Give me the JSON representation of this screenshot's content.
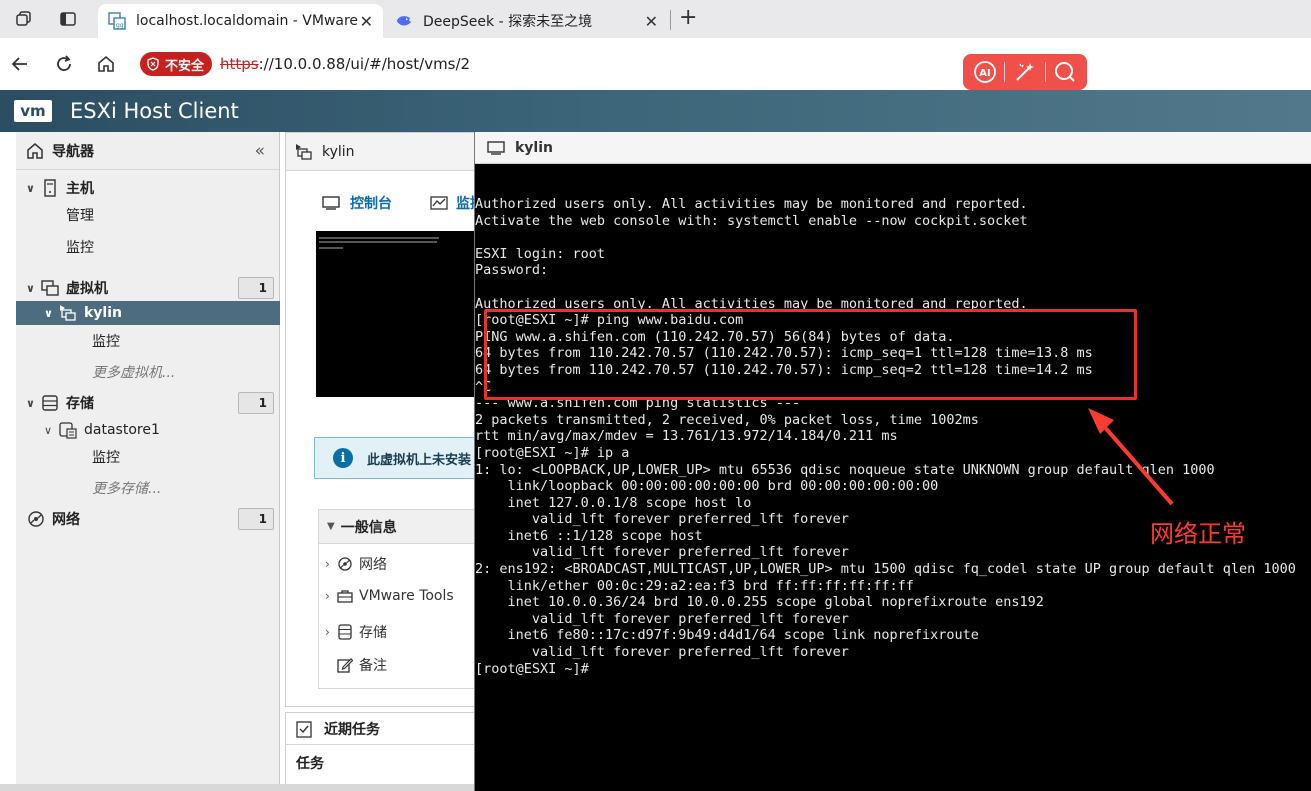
{
  "browser": {
    "tabs": [
      {
        "title": "localhost.localdomain - VMware E",
        "active": true
      },
      {
        "title": "DeepSeek - 探索未至之境",
        "active": false
      }
    ],
    "close_glyph": "✕",
    "new_tab_glyph": "+",
    "insecure_label": "不安全",
    "url_scheme": "https",
    "url_rest": "://10.0.0.88/ui/#/host/vms/2",
    "ai_label": "AI"
  },
  "esxi": {
    "logo": "vm",
    "title": "ESXi Host Client"
  },
  "navigator": {
    "title": "导航器",
    "collapse_glyph": "«",
    "host": {
      "label": "主机",
      "children": [
        "管理",
        "监控"
      ]
    },
    "vms": {
      "label": "虚拟机",
      "count": "1",
      "selected": "kylin",
      "children": [
        "监控"
      ],
      "more": "更多虚拟机..."
    },
    "storage": {
      "label": "存储",
      "count": "1",
      "datastore": "datastore1",
      "children": [
        "监控"
      ],
      "more": "更多存储..."
    },
    "network": {
      "label": "网络",
      "count": "1"
    }
  },
  "vm_panel": {
    "title": "kylin",
    "console_label": "控制台",
    "monitor_label": "监控",
    "info_text": "此虚拟机上未安装",
    "general": {
      "title": "一般信息",
      "rows": [
        "网络",
        "VMware Tools",
        "存储",
        "备注"
      ]
    }
  },
  "tasks": {
    "title": "近期任务",
    "sub": "任务"
  },
  "console_window": {
    "title": "kylin",
    "lines": [
      "Authorized users only. All activities may be monitored and reported.",
      "Activate the web console with: systemctl enable --now cockpit.socket",
      "",
      "ESXI login: root",
      "Password:",
      "",
      "Authorized users only. All activities may be monitored and reported.",
      "[root@ESXI ~]# ping www.baidu.com",
      "PING www.a.shifen.com (110.242.70.57) 56(84) bytes of data.",
      "64 bytes from 110.242.70.57 (110.242.70.57): icmp_seq=1 ttl=128 time=13.8 ms",
      "64 bytes from 110.242.70.57 (110.242.70.57): icmp_seq=2 ttl=128 time=14.2 ms",
      "^C",
      "--- www.a.shifen.com ping statistics ---",
      "2 packets transmitted, 2 received, 0% packet loss, time 1002ms",
      "rtt min/avg/max/mdev = 13.761/13.972/14.184/0.211 ms",
      "[root@ESXI ~]# ip a",
      "1: lo: <LOOPBACK,UP,LOWER_UP> mtu 65536 qdisc noqueue state UNKNOWN group default qlen 1000",
      "    link/loopback 00:00:00:00:00:00 brd 00:00:00:00:00:00",
      "    inet 127.0.0.1/8 scope host lo",
      "       valid_lft forever preferred_lft forever",
      "    inet6 ::1/128 scope host",
      "       valid_lft forever preferred_lft forever",
      "2: ens192: <BROADCAST,MULTICAST,UP,LOWER_UP> mtu 1500 qdisc fq_codel state UP group default qlen 1000",
      "    link/ether 00:0c:29:a2:ea:f3 brd ff:ff:ff:ff:ff:ff",
      "    inet 10.0.0.36/24 brd 10.0.0.255 scope global noprefixroute ens192",
      "       valid_lft forever preferred_lft forever",
      "    inet6 fe80::17c:d97f:9b49:d4d1/64 scope link noprefixroute",
      "       valid_lft forever preferred_lft forever",
      "[root@ESXI ~]#"
    ]
  },
  "annotation": {
    "text": "网络正常",
    "color": "#ff3a2f"
  },
  "colors": {
    "esxi_header": "#3c6579",
    "selected_row": "#4e6c7f",
    "link": "#0d6aa8",
    "insecure": "#c5221f",
    "ai_pill": "#f0504a"
  }
}
